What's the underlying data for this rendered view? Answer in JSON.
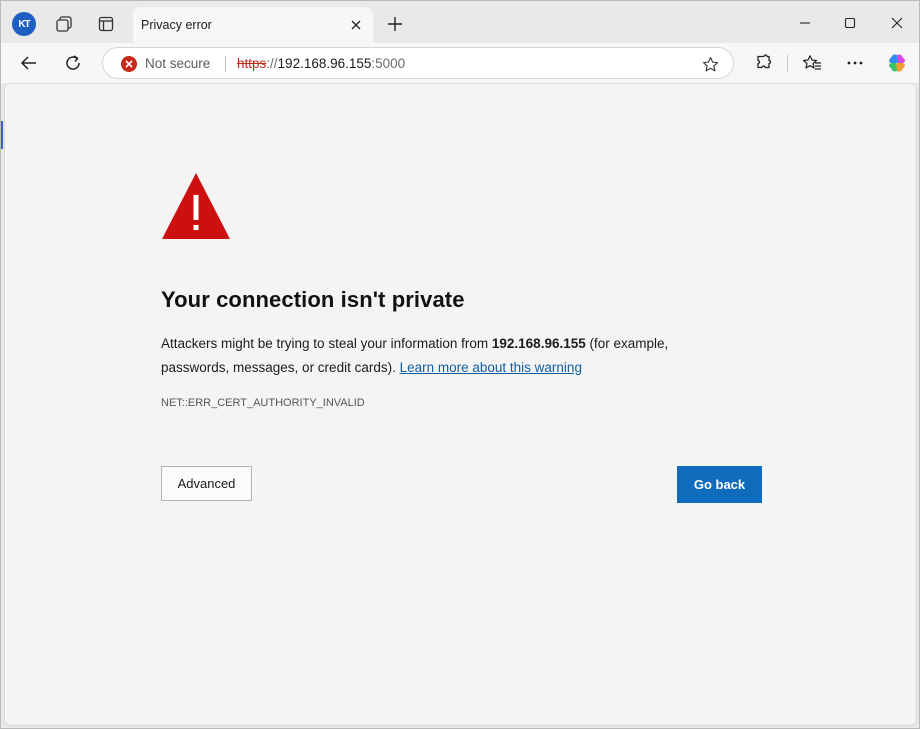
{
  "browser": {
    "profile_initials": "KT",
    "tab_title": "Privacy error",
    "security_label": "Not secure",
    "url_scheme": "https",
    "url_separator": "://",
    "url_host": "192.168.96.155",
    "url_port": ":5000"
  },
  "page": {
    "heading": "Your connection isn't private",
    "desc_before": "Attackers might be trying to steal your information from ",
    "desc_host": "192.168.96.155",
    "desc_after": " (for example, passwords, messages, or credit cards). ",
    "learn_more": "Learn more about this warning",
    "error_code": "NET::ERR_CERT_AUTHORITY_INVALID",
    "advanced_label": "Advanced",
    "go_back_label": "Go back"
  },
  "colors": {
    "warning": "#d11a1a",
    "primary_button": "#0f6cbd",
    "link": "#115ea3"
  },
  "icons": [
    "profile-avatar",
    "workspaces-icon",
    "vertical-tabs-icon",
    "close-tab-icon",
    "new-tab-icon",
    "minimize-icon",
    "maximize-icon",
    "close-window-icon",
    "back-icon",
    "refresh-icon",
    "not-secure-icon",
    "favorite-star-icon",
    "extensions-icon",
    "favorites-icon",
    "more-icon",
    "copilot-icon",
    "warning-triangle-icon"
  ]
}
